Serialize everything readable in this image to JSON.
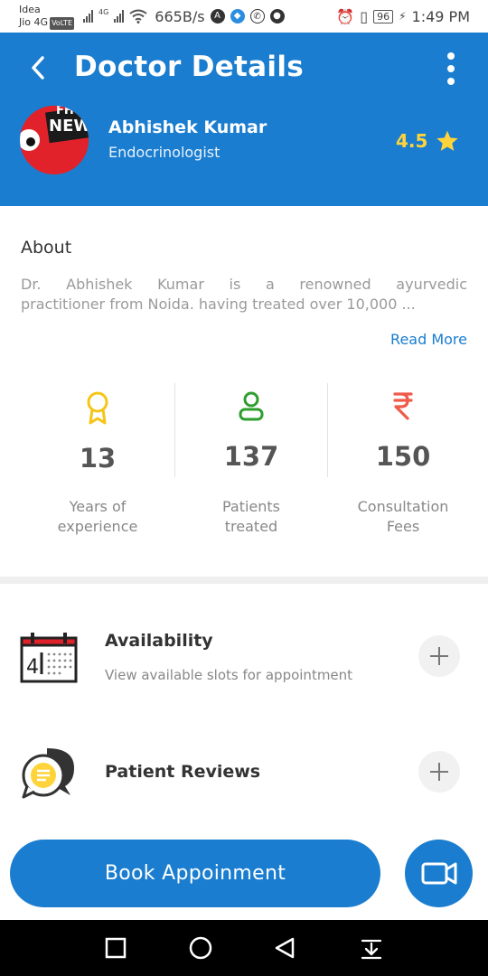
{
  "status_bar": {
    "carrier_1": "Idea",
    "carrier_2": "Jio 4G",
    "volte": "VoLTE",
    "net_type": "4G",
    "speed": "665B/s",
    "battery": "96",
    "time": "1:49 PM"
  },
  "header": {
    "title": "Doctor Details",
    "doctor_name": "Abhishek Kumar",
    "specialty": "Endocrinologist",
    "rating": "4.5",
    "avatar_text_1": "FH",
    "avatar_text_2": "NEW"
  },
  "about": {
    "title": "About",
    "line_1": "Dr. Abhishek Kumar is a renowned ayurvedic",
    "line_2": "practitioner from Noida. having treated over 10,000 ...",
    "read_more": "Read More"
  },
  "stats": [
    {
      "value": "13",
      "label_1": "Years of",
      "label_2": "experience",
      "icon": "award-icon",
      "color": "#f5c518"
    },
    {
      "value": "137",
      "label_1": "Patients",
      "label_2": "treated",
      "icon": "user-icon",
      "color": "#2e9e2e"
    },
    {
      "value": "150",
      "label_1": "Consultation",
      "label_2": "Fees",
      "icon": "rupee-icon",
      "color": "#f05a4a"
    }
  ],
  "availability": {
    "title": "Availability",
    "subtitle": "View available slots for appointment",
    "calendar_day": "4"
  },
  "reviews": {
    "title": "Patient Reviews"
  },
  "actions": {
    "book_label": "Book Appoinment"
  },
  "colors": {
    "primary": "#1a7dcf",
    "rating": "#ffd43b"
  }
}
